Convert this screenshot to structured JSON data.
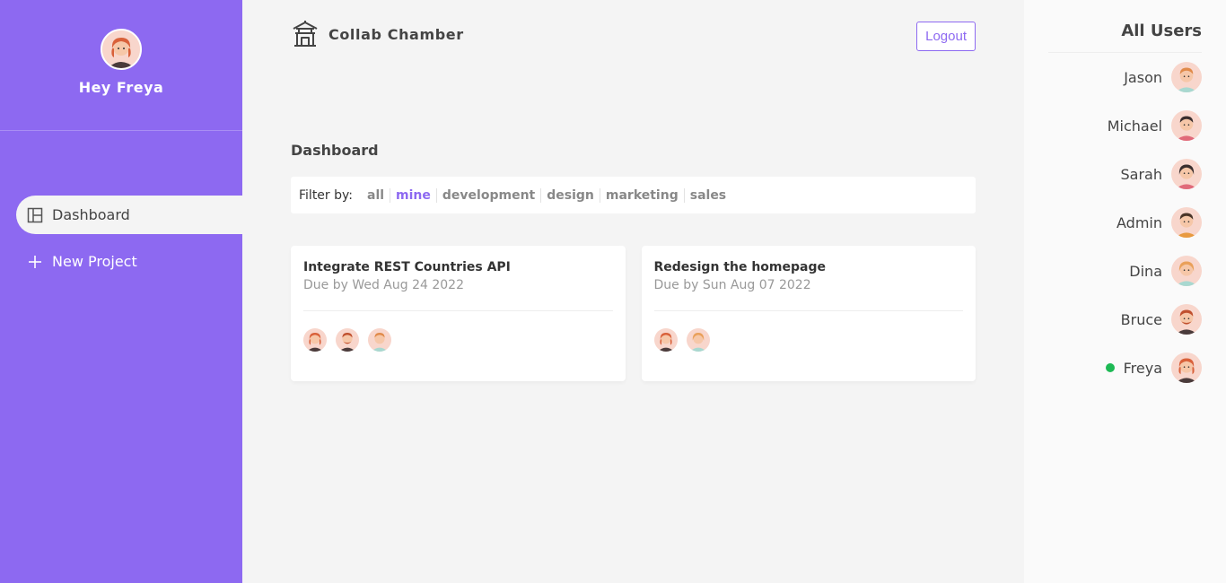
{
  "sidebar": {
    "greeting": "Hey Freya",
    "nav": [
      {
        "label": "Dashboard",
        "icon": "dashboard-icon",
        "active": true
      },
      {
        "label": "New Project",
        "icon": "plus-icon",
        "active": false
      }
    ]
  },
  "header": {
    "brand": "Collab Chamber",
    "logout_label": "Logout"
  },
  "main": {
    "title": "Dashboard",
    "filter": {
      "label": "Filter by:",
      "options": [
        "all",
        "mine",
        "development",
        "design",
        "marketing",
        "sales"
      ],
      "selected": "mine"
    },
    "projects": [
      {
        "title": "Integrate REST Countries API",
        "due": "Due by Wed Aug 24 2022",
        "assigned": [
          "Freya",
          "Bruce",
          "Jason"
        ]
      },
      {
        "title": "Redesign the homepage",
        "due": "Due by Sun Aug 07 2022",
        "assigned": [
          "Freya",
          "Dina"
        ]
      }
    ]
  },
  "users_panel": {
    "heading": "All Users",
    "users": [
      {
        "name": "Jason",
        "online": false
      },
      {
        "name": "Michael",
        "online": false
      },
      {
        "name": "Sarah",
        "online": false
      },
      {
        "name": "Admin",
        "online": false
      },
      {
        "name": "Dina",
        "online": false
      },
      {
        "name": "Bruce",
        "online": false
      },
      {
        "name": "Freya",
        "online": true
      }
    ]
  },
  "colors": {
    "accent": "#8d69f1",
    "online": "#1db954"
  }
}
